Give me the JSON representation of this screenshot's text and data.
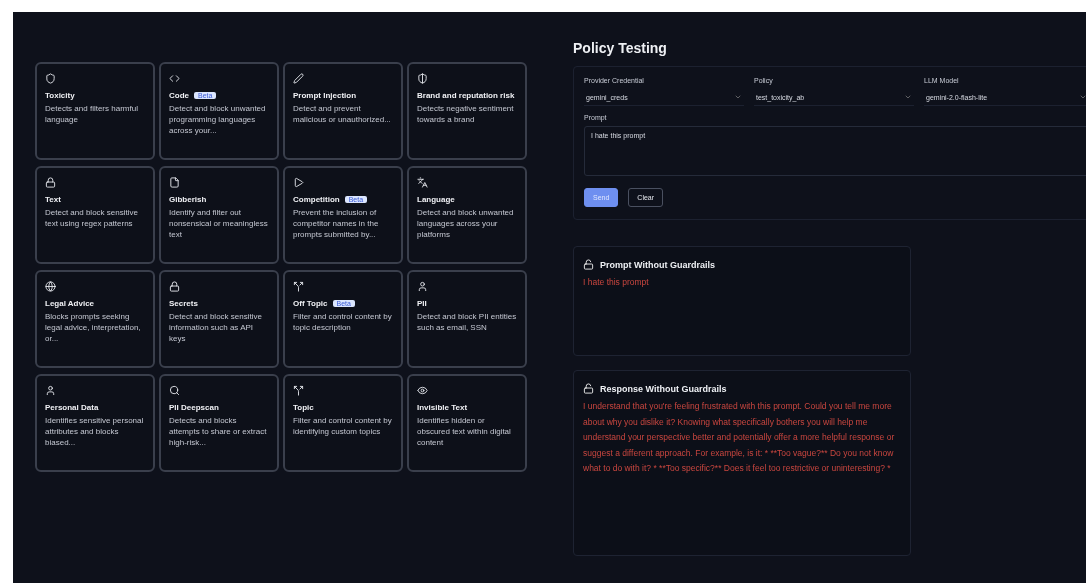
{
  "guardrails": [
    {
      "title": "Toxicity",
      "description": "Detects and filters harmful language"
    },
    {
      "title": "Code",
      "badge": "Beta",
      "description": "Detect and block unwanted programming languages across your..."
    },
    {
      "title": "Prompt Injection",
      "description": "Detect and prevent malicious or unauthorized..."
    },
    {
      "title": "Brand and reputation risk",
      "description": "Detects negative sentiment towards a brand"
    },
    {
      "title": "Text",
      "description": "Detect and block sensitive text using regex patterns"
    },
    {
      "title": "Gibberish",
      "description": "Identify and filter out nonsensical or meaningless text"
    },
    {
      "title": "Competition",
      "badge": "Beta",
      "description": "Prevent the inclusion of competitor names in the prompts submitted by..."
    },
    {
      "title": "Language",
      "description": "Detect and block unwanted languages across your platforms"
    },
    {
      "title": "Legal Advice",
      "description": "Blocks prompts seeking legal advice, interpretation, or..."
    },
    {
      "title": "Secrets",
      "description": "Detect and block sensitive information such as API keys"
    },
    {
      "title": "Off Topic",
      "badge": "Beta",
      "description": "Filter and control content by topic description"
    },
    {
      "title": "PII",
      "description": "Detect and block PII entities such as email, SSN"
    },
    {
      "title": "Personal Data",
      "description": "Identifies sensitive personal attributes and blocks biased..."
    },
    {
      "title": "PII Deepscan",
      "description": "Detects and blocks attempts to share or extract high-risk..."
    },
    {
      "title": "Topic",
      "description": "Filter and control content by identifying custom topics"
    },
    {
      "title": "Invisible Text",
      "description": "Identifies hidden or obscured text within digital content"
    }
  ],
  "panel_title": "Policy Testing",
  "selects": [
    {
      "label": "Provider Credential",
      "value": "gemini_creds"
    },
    {
      "label": "Policy",
      "value": "test_toxicity_ab"
    },
    {
      "label": "LLM Model",
      "value": "gemini-2.0-flash-lite"
    }
  ],
  "prompt": {
    "label": "Prompt",
    "value": "I hate this prompt"
  },
  "buttons": [
    {
      "label": "Send",
      "kind": "primary"
    },
    {
      "label": "Clear",
      "kind": "outline"
    }
  ],
  "results": [
    {
      "title": "Prompt Without Guardrails",
      "text": "I hate this prompt"
    },
    {
      "title": "Response Without Guardrails",
      "text": "I understand that you're feeling frustrated with this prompt. Could you tell me more about why you dislike it? Knowing what specifically bothers you will help me understand your perspective better and potentially offer a more helpful response or suggest a different approach. For example, is it: * **Too vague?** Do you not know what to do with it? * **Too specific?** Does it feel too restrictive or uninteresting? *"
    }
  ]
}
